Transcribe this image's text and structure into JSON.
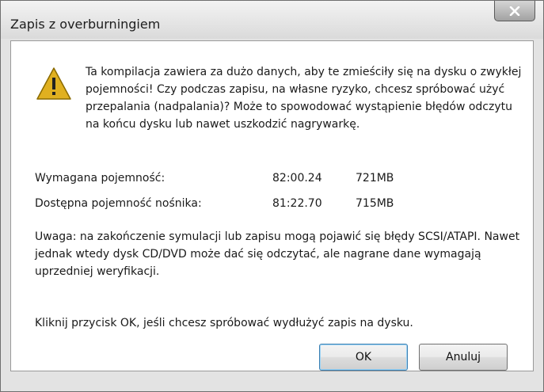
{
  "window": {
    "title": "Zapis z overburningiem",
    "close_symbol": "X"
  },
  "icon": "warning-icon",
  "message": "Ta kompilacja zawiera za dużo danych, aby te zmieściły się na dysku o zwykłej pojemności! Czy podczas zapisu, na własne ryzyko, chcesz spróbować użyć przepalania (nadpalania)? Może to spowodować wystąpienie błędów odczytu na końcu dysku lub nawet uszkodzić nagrywarkę.",
  "capacity": {
    "required": {
      "label": "Wymagana pojemność:",
      "time": "82:00.24",
      "size": "721MB"
    },
    "available": {
      "label": "Dostępna pojemność nośnika:",
      "time": "81:22.70",
      "size": "715MB"
    }
  },
  "note": "Uwaga: na zakończenie symulacji lub zapisu mogą pojawić się błędy SCSI/ATAPI. Nawet jednak wtedy dysk CD/DVD może dać się odczytać, ale nagrane dane wymagają uprzedniej weryfikacji.",
  "prompt": "Kliknij przycisk OK, jeśli chcesz spróbować wydłużyć zapis na dysku.",
  "buttons": {
    "ok": "OK",
    "cancel": "Anuluj"
  }
}
